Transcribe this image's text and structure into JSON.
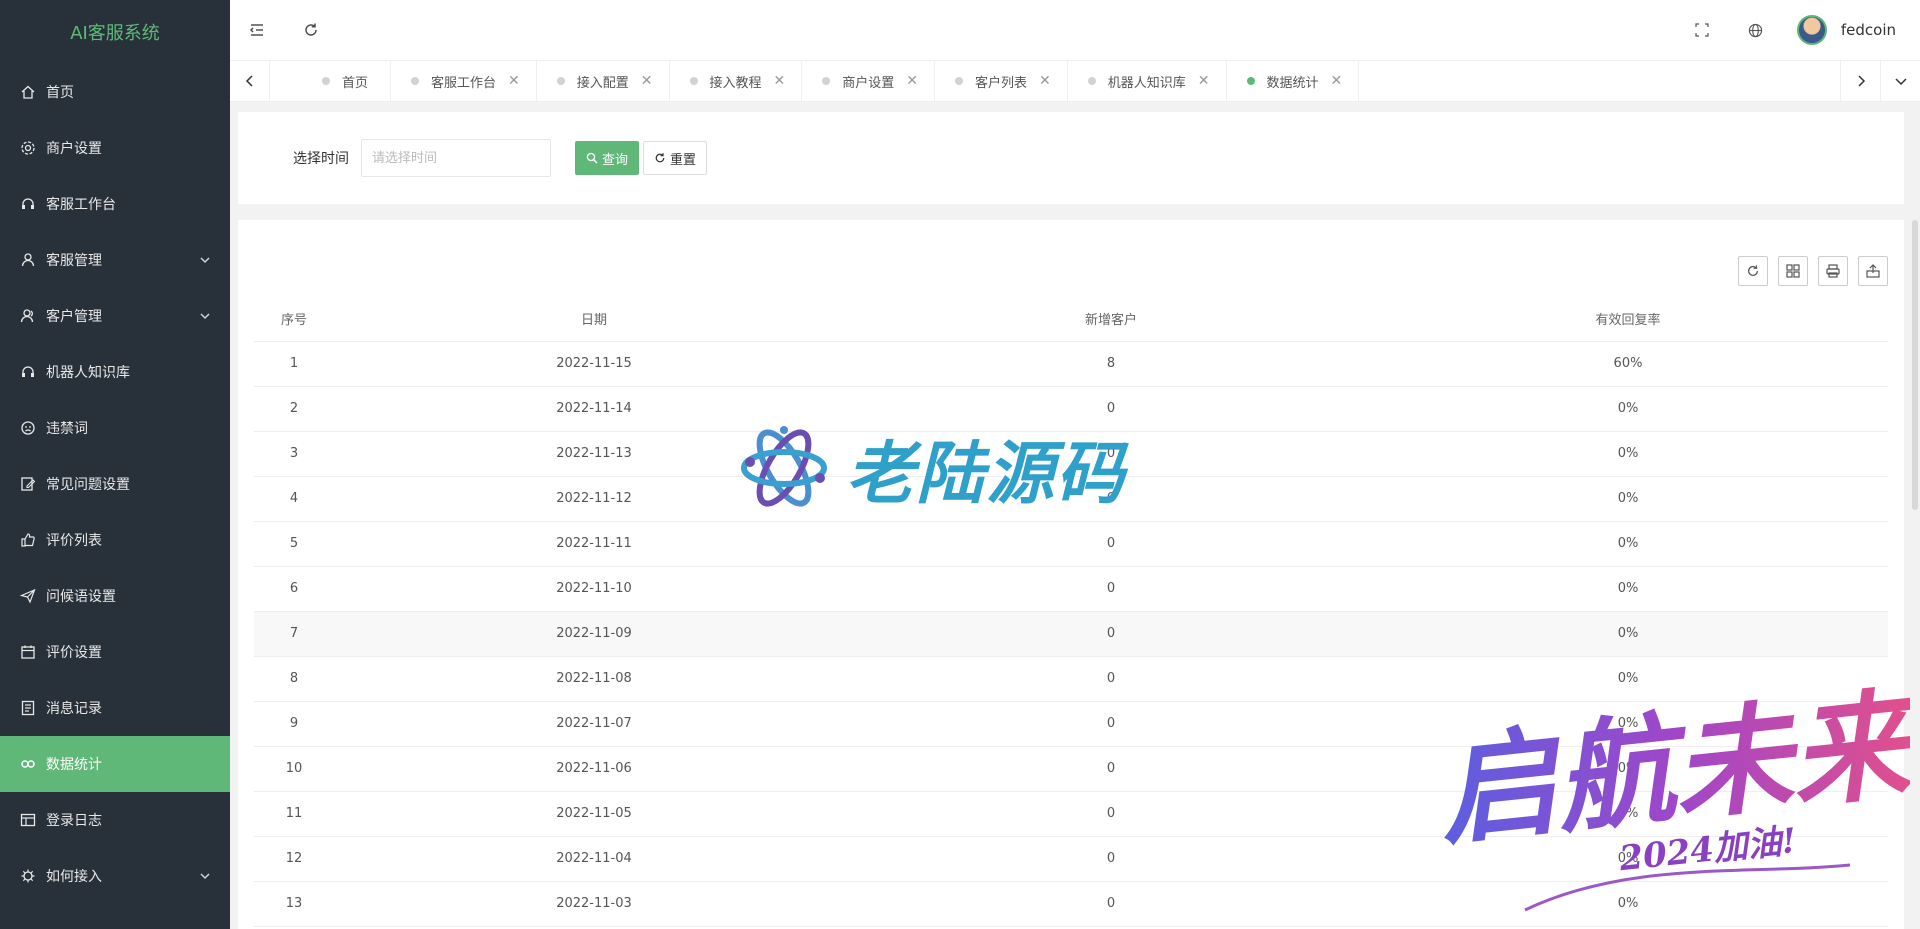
{
  "app": {
    "title": "AI客服系统"
  },
  "sidebar": {
    "items": [
      {
        "label": "首页",
        "icon": "home-icon"
      },
      {
        "label": "商户设置",
        "icon": "gear-icon"
      },
      {
        "label": "客服工作台",
        "icon": "headset-icon"
      },
      {
        "label": "客服管理",
        "icon": "user-icon",
        "expandable": true
      },
      {
        "label": "客户管理",
        "icon": "users-icon",
        "expandable": true
      },
      {
        "label": "机器人知识库",
        "icon": "robot-icon"
      },
      {
        "label": "违禁词",
        "icon": "face-icon"
      },
      {
        "label": "常见问题设置",
        "icon": "edit-icon"
      },
      {
        "label": "评价列表",
        "icon": "thumbs-up-icon"
      },
      {
        "label": "问候语设置",
        "icon": "send-icon"
      },
      {
        "label": "评价设置",
        "icon": "calendar-icon"
      },
      {
        "label": "消息记录",
        "icon": "list-icon"
      },
      {
        "label": "数据统计",
        "icon": "link-icon",
        "active": true
      },
      {
        "label": "登录日志",
        "icon": "table-icon"
      },
      {
        "label": "如何接入",
        "icon": "bug-icon",
        "expandable": true
      }
    ]
  },
  "header": {
    "username": "fedcoin"
  },
  "tabs": [
    {
      "label": "首页",
      "closable": false
    },
    {
      "label": "客服工作台",
      "closable": true
    },
    {
      "label": "接入配置",
      "closable": true
    },
    {
      "label": "接入教程",
      "closable": true
    },
    {
      "label": "商户设置",
      "closable": true
    },
    {
      "label": "客户列表",
      "closable": true
    },
    {
      "label": "机器人知识库",
      "closable": true
    },
    {
      "label": "数据统计",
      "closable": true,
      "active": true
    }
  ],
  "search": {
    "label": "选择时间",
    "placeholder": "请选择时间",
    "query_label": "查询",
    "reset_label": "重置"
  },
  "table": {
    "columns": [
      "序号",
      "日期",
      "新增客户",
      "有效回复率"
    ],
    "rows": [
      [
        "1",
        "2022-11-15",
        "8",
        "60%"
      ],
      [
        "2",
        "2022-11-14",
        "0",
        "0%"
      ],
      [
        "3",
        "2022-11-13",
        "0",
        "0%"
      ],
      [
        "4",
        "2022-11-12",
        "0",
        "0%"
      ],
      [
        "5",
        "2022-11-11",
        "0",
        "0%"
      ],
      [
        "6",
        "2022-11-10",
        "0",
        "0%"
      ],
      [
        "7",
        "2022-11-09",
        "0",
        "0%"
      ],
      [
        "8",
        "2022-11-08",
        "0",
        "0%"
      ],
      [
        "9",
        "2022-11-07",
        "0",
        "0%"
      ],
      [
        "10",
        "2022-11-06",
        "0",
        "0%"
      ],
      [
        "11",
        "2022-11-05",
        "0",
        "0%"
      ],
      [
        "12",
        "2022-11-04",
        "0",
        "0%"
      ],
      [
        "13",
        "2022-11-03",
        "0",
        "0%"
      ]
    ],
    "highlight_row": 7
  },
  "watermarks": {
    "brand": "老陆源码",
    "slogan": "启航未来",
    "slogan_sub": "2024加油!"
  },
  "colors": {
    "accent": "#5fb878",
    "sidebar_bg": "#283139"
  }
}
